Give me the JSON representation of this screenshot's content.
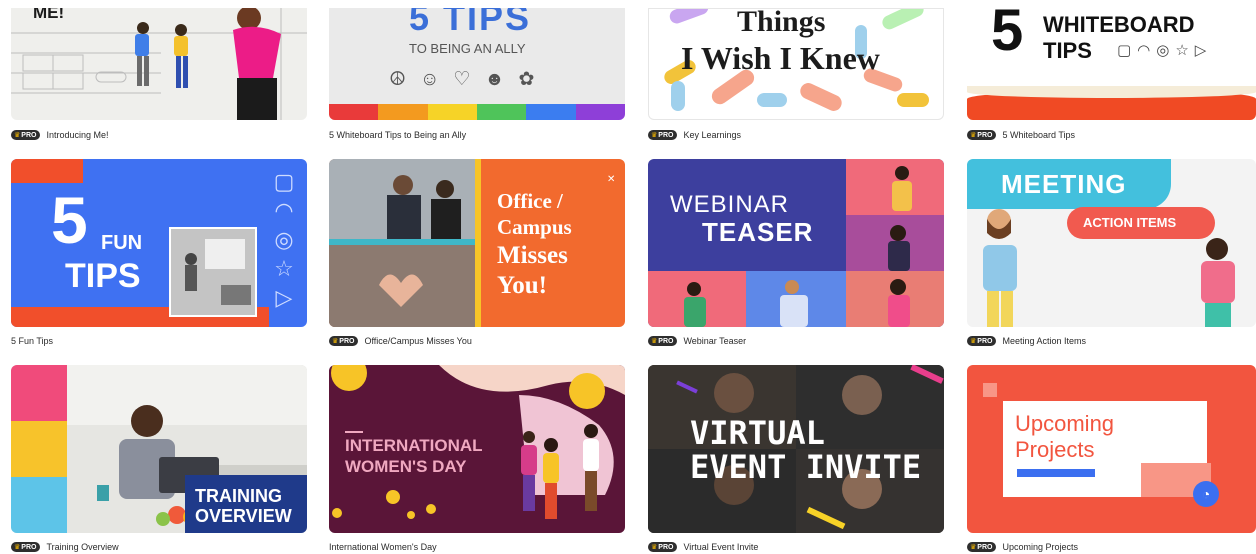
{
  "badge": {
    "label": "PRO",
    "crown_icon": "crown-icon"
  },
  "cards": [
    {
      "title": "Introducing Me!",
      "pro": true,
      "thumb_text": [
        "ME!"
      ]
    },
    {
      "title": "5 Whiteboard Tips to Being an Ally",
      "pro": false,
      "thumb_text": [
        "5 TIPS",
        "TO BEING AN ALLY"
      ]
    },
    {
      "title": "Key Learnings",
      "pro": true,
      "thumb_text": [
        "Things",
        "I Wish I Knew"
      ]
    },
    {
      "title": "5 Whiteboard Tips",
      "pro": true,
      "thumb_text": [
        "5",
        "WHITEBOARD",
        "TIPS"
      ]
    },
    {
      "title": "5 Fun Tips",
      "pro": false,
      "thumb_text": [
        "5",
        "FUN",
        "TIPS"
      ]
    },
    {
      "title": "Office/Campus Misses You",
      "pro": true,
      "thumb_text": [
        "Office /",
        "Campus",
        "Misses",
        "You!"
      ]
    },
    {
      "title": "Webinar Teaser",
      "pro": true,
      "thumb_text": [
        "WEBINAR",
        "TEASER"
      ]
    },
    {
      "title": "Meeting Action Items",
      "pro": true,
      "thumb_text": [
        "MEETING",
        "ACTION ITEMS"
      ]
    },
    {
      "title": "Training Overview",
      "pro": true,
      "thumb_text": [
        "TRAINING",
        "OVERVIEW"
      ]
    },
    {
      "title": "International Women's Day",
      "pro": false,
      "thumb_text": [
        "INTERNATIONAL",
        "WOMEN'S DAY"
      ]
    },
    {
      "title": "Virtual Event Invite",
      "pro": true,
      "thumb_text": [
        "VIRTUAL",
        "EVENT INVITE"
      ]
    },
    {
      "title": "Upcoming Projects",
      "pro": true,
      "thumb_text": [
        "Upcoming",
        "Projects"
      ]
    }
  ],
  "colors": {
    "pro_badge_bg": "#2e2e2e",
    "crown": "#f5b800",
    "caption_text": "#2b2b2b"
  }
}
